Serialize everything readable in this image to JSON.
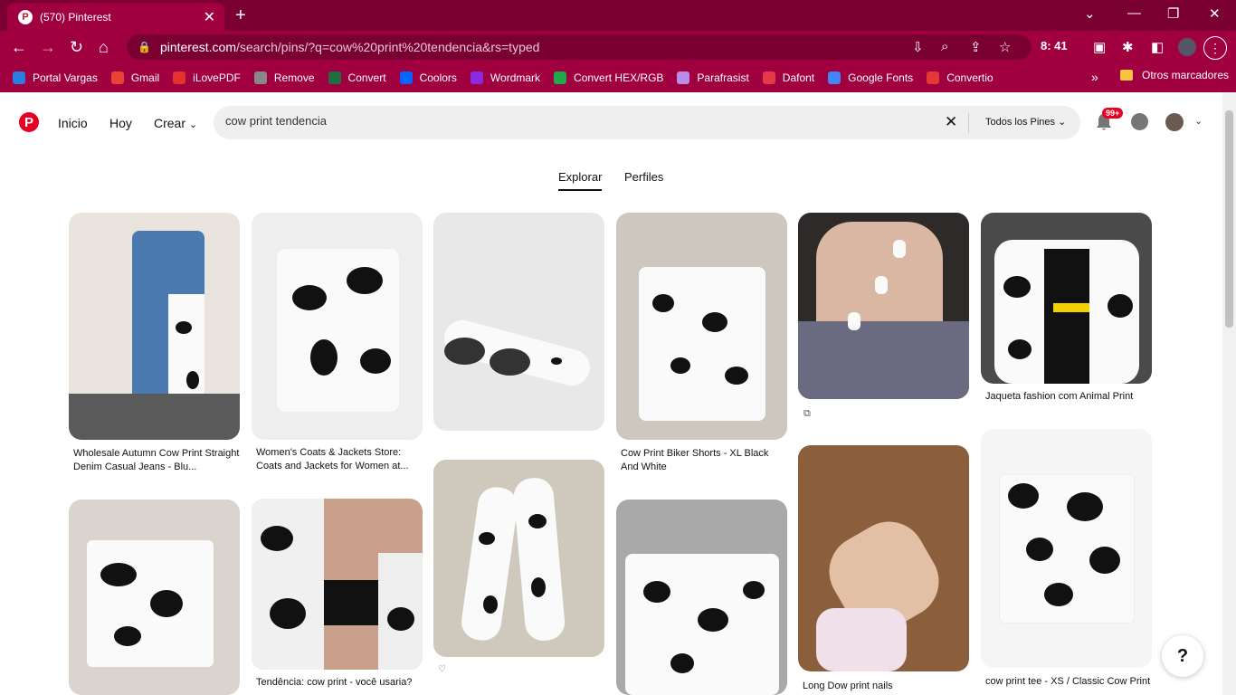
{
  "browser": {
    "tab_title": "(570) Pinterest",
    "url_domain": "pinterest.com",
    "url_path": "/search/pins/?q=cow%20print%20tendencia&rs=typed",
    "clock": "8: 41",
    "bookmarks": [
      {
        "label": "Portal Vargas",
        "color": "#2a7de1"
      },
      {
        "label": "Gmail",
        "color": "#ea4335"
      },
      {
        "label": "iLovePDF",
        "color": "#e5322d"
      },
      {
        "label": "Remove",
        "color": "#888888"
      },
      {
        "label": "Convert",
        "color": "#1d6f42"
      },
      {
        "label": "Coolors",
        "color": "#0066ff"
      },
      {
        "label": "Wordmark",
        "color": "#8a2be2"
      },
      {
        "label": "Convert HEX/RGB",
        "color": "#1fa94a"
      },
      {
        "label": "Parafrasist",
        "color": "#b78de8"
      },
      {
        "label": "Dafont",
        "color": "#e63946"
      },
      {
        "label": "Google Fonts",
        "color": "#4285f4"
      },
      {
        "label": "Convertio",
        "color": "#e53935"
      }
    ],
    "more": "»",
    "other_bookmarks": "Otros marcadores"
  },
  "header": {
    "nav": [
      "Inicio",
      "Hoy",
      "Crear"
    ],
    "search_value": "cow print tendencia",
    "filter": "Todos los Pines",
    "notifications": "99+"
  },
  "tabs": [
    "Explorar",
    "Perfiles"
  ],
  "pins": [
    {
      "caption": "Wholesale Autumn Cow Print Straight Denim Casual Jeans - Blu..."
    },
    {
      "caption": "Women's Coats & Jackets Store: Coats and Jackets for Women at..."
    },
    {
      "caption": "Cow Print Biker Shorts - XL Black And White"
    },
    {
      "caption": "Jaqueta fashion com Animal Print"
    },
    {
      "caption": "Tendência: cow print - você usaria?"
    },
    {
      "caption": "Long Dow print nails"
    },
    {
      "caption": "cow print tee - XS / Classic Cow Print"
    }
  ],
  "help": "?"
}
